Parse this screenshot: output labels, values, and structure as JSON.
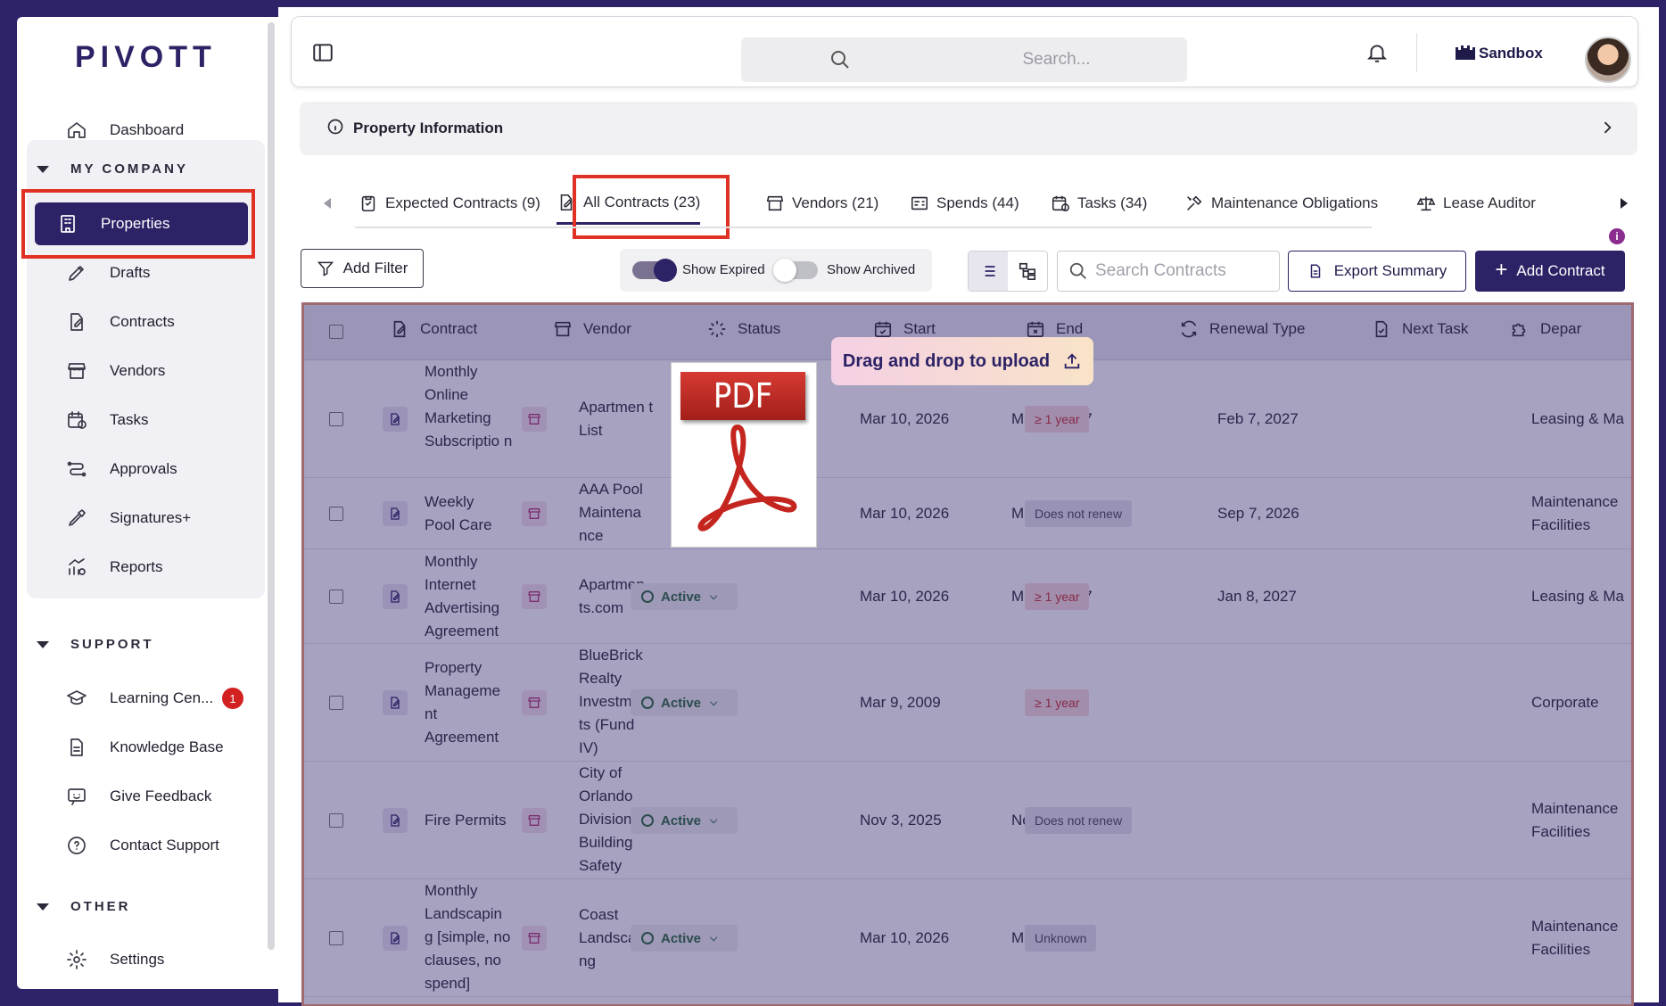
{
  "sidebar": {
    "logo": "PIVOTT",
    "dashboard": "Dashboard",
    "my_company": "MY COMPANY",
    "items": [
      "Properties",
      "Drafts",
      "Contracts",
      "Vendors",
      "Tasks",
      "Approvals",
      "Signatures+",
      "Reports"
    ],
    "support": "SUPPORT",
    "support_items": [
      "Learning Cen...",
      "Knowledge Base",
      "Give Feedback",
      "Contact Support"
    ],
    "learning_badge": "1",
    "other": "OTHER",
    "other_items": [
      "Settings"
    ]
  },
  "topbar": {
    "search_placeholder": "Search...",
    "workspace": "Sandbox"
  },
  "property_info": "Property Information",
  "tabs": [
    "Expected Contracts (9)",
    "All Contracts (23)",
    "Vendors (21)",
    "Spends (44)",
    "Tasks (34)",
    "Maintenance Obligations",
    "Lease Auditor"
  ],
  "toolbar": {
    "add_filter": "Add Filter",
    "show_expired": "Show Expired",
    "show_archived": "Show Archived",
    "search_contracts": "Search Contracts",
    "export_summary": "Export Summary",
    "add_contract": "Add Contract"
  },
  "table": {
    "headers": [
      "Contract",
      "Vendor",
      "Status",
      "Start",
      "End",
      "Renewal Type",
      "Next Task",
      "Depar"
    ],
    "rows": [
      {
        "contract": "Monthly Online Marketing Subscriptio n",
        "vendor": "Apartmen t List",
        "status": "",
        "start": "Mar 10, 2026",
        "end": "Mar 9, 2027",
        "renewal": "≥ 1 year",
        "next_task": "Feb 7, 2027",
        "dept": "Leasing & Ma"
      },
      {
        "contract": "Weekly Pool Care",
        "vendor": "AAA Pool Maintena nce",
        "status": "",
        "start": "Mar 10, 2026",
        "end": "Mar 9, 2027",
        "renewal": "Does not renew",
        "next_task": "Sep 7, 2026",
        "dept": "Maintenance Facilities"
      },
      {
        "contract": "Monthly Internet Advertising Agreement",
        "vendor": "Apartmen ts.com",
        "status": "Active",
        "start": "Mar 10, 2026",
        "end": "Mar 9, 2027",
        "renewal": "≥ 1 year",
        "next_task": "Jan 8, 2027",
        "dept": "Leasing & Ma"
      },
      {
        "contract": "Property Manageme nt Agreement",
        "vendor": "BlueBrick Realty Investmen ts (Fund IV)",
        "status": "Active",
        "start": "Mar 9, 2009",
        "end": "",
        "renewal": "≥ 1 year",
        "next_task": "",
        "dept": "Corporate"
      },
      {
        "contract": "Fire Permits",
        "vendor": "City of Orlando Division of Building Safety",
        "status": "Active",
        "start": "Nov 3, 2025",
        "end": "Nov 3, 2026",
        "renewal": "Does not renew",
        "next_task": "",
        "dept": "Maintenance Facilities"
      },
      {
        "contract": "Monthly Landscapin g [simple, no clauses, no spend]",
        "vendor": "Coast Landscapi ng",
        "status": "Active",
        "start": "Mar 10, 2026",
        "end": "Mar 9, 2027",
        "renewal": "Unknown",
        "next_task": "",
        "dept": "Maintenance Facilities"
      }
    ]
  },
  "drag_drop": "Drag and drop to upload",
  "pdf_label": "PDF"
}
